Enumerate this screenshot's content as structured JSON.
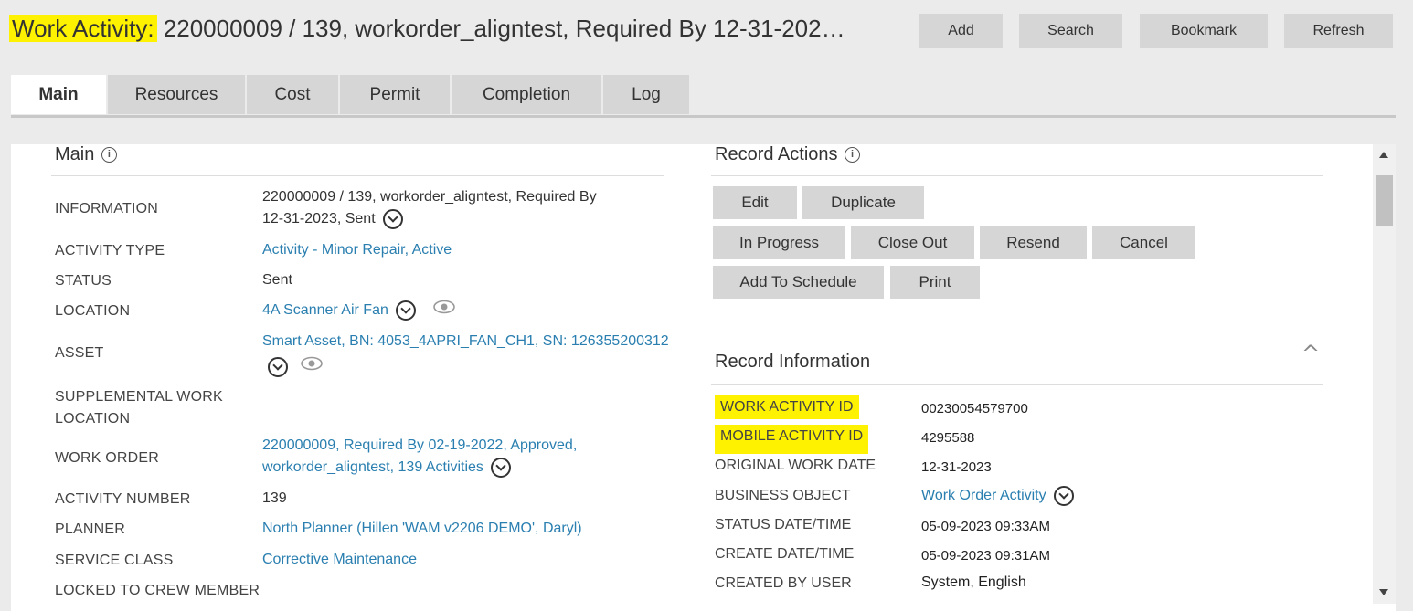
{
  "header": {
    "title_prefix": "Work Activity:",
    "title_rest": " 220000009 / 139, workorder_aligntest, Required By 12-31-202…",
    "buttons": {
      "add": "Add",
      "search": "Search",
      "bookmark": "Bookmark",
      "refresh": "Refresh"
    }
  },
  "tabs": [
    "Main",
    "Resources",
    "Cost",
    "Permit",
    "Completion",
    "Log"
  ],
  "main_section": {
    "title": "Main",
    "fields": {
      "information": {
        "label": "INFORMATION",
        "value_line1": "220000009 / 139, workorder_aligntest, Required By",
        "value_line2": "12-31-2023, Sent"
      },
      "activity_type": {
        "label": "ACTIVITY TYPE",
        "value": "Activity - Minor Repair, Active"
      },
      "status": {
        "label": "STATUS",
        "value": "Sent"
      },
      "location": {
        "label": "LOCATION",
        "value": "4A Scanner Air Fan"
      },
      "asset": {
        "label": "ASSET",
        "value": "Smart Asset, BN: 4053_4APRI_FAN_CH1, SN: 126355200312"
      },
      "supplemental": {
        "label_line1": "SUPPLEMENTAL WORK",
        "label_line2": "LOCATION"
      },
      "work_order": {
        "label": "WORK ORDER",
        "value_line1": "220000009, Required By 02-19-2022, Approved,",
        "value_line2": "workorder_aligntest, 139 Activities"
      },
      "activity_number": {
        "label": "ACTIVITY NUMBER",
        "value": "139"
      },
      "planner": {
        "label": "PLANNER",
        "value": "North Planner (Hillen 'WAM v2206 DEMO', Daryl)"
      },
      "service_class": {
        "label": "SERVICE CLASS",
        "value": "Corrective Maintenance"
      },
      "locked": {
        "label": "LOCKED TO CREW MEMBER"
      }
    }
  },
  "record_actions": {
    "title": "Record Actions",
    "buttons": {
      "edit": "Edit",
      "duplicate": "Duplicate",
      "in_progress": "In Progress",
      "close_out": "Close Out",
      "resend": "Resend",
      "cancel": "Cancel",
      "add_to_schedule": "Add To Schedule",
      "print": "Print"
    }
  },
  "record_information": {
    "title": "Record Information",
    "fields": {
      "work_activity_id": {
        "label": "WORK ACTIVITY ID",
        "value": "00230054579700"
      },
      "mobile_activity_id": {
        "label": "MOBILE ACTIVITY ID",
        "value": "4295588"
      },
      "original_work_date": {
        "label": "ORIGINAL WORK DATE",
        "value": "12-31-2023"
      },
      "business_object": {
        "label": "BUSINESS OBJECT",
        "value": "Work Order Activity"
      },
      "status_datetime": {
        "label": "STATUS DATE/TIME",
        "value": "05-09-2023 09:33AM"
      },
      "create_datetime": {
        "label": "CREATE DATE/TIME",
        "value": "05-09-2023 09:31AM"
      },
      "created_by_user": {
        "label": "CREATED BY USER",
        "value": "System, English"
      }
    }
  },
  "colors": {
    "highlight": "#fff200",
    "link": "#2a7fb0",
    "button": "#d6d6d6"
  }
}
